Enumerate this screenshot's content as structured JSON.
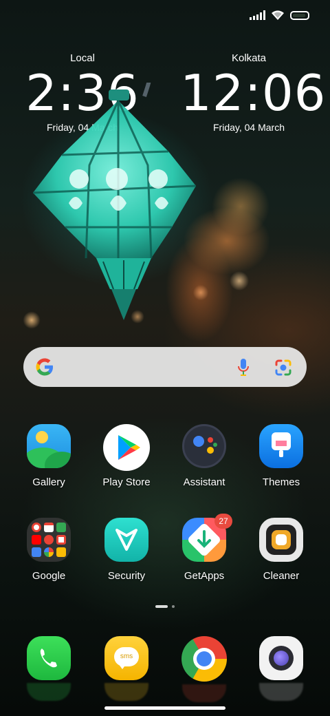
{
  "clocks": {
    "local": {
      "city": "Local",
      "time": "2:36",
      "date": "Friday, 04 March"
    },
    "remote": {
      "city": "Kolkata",
      "time": "12:06",
      "date": "Friday, 04 March"
    }
  },
  "status_bar": {
    "icons": [
      "signal-icon",
      "wifi-icon",
      "battery-icon"
    ]
  },
  "search": {
    "icons": [
      "google-logo-icon",
      "mic-icon",
      "google-lens-icon"
    ]
  },
  "apps": {
    "row1": [
      {
        "label": "Gallery",
        "icon": "gallery-icon"
      },
      {
        "label": "Play Store",
        "icon": "play-store-icon"
      },
      {
        "label": "Assistant",
        "icon": "assistant-icon"
      },
      {
        "label": "Themes",
        "icon": "themes-icon"
      }
    ],
    "row2": [
      {
        "label": "Google",
        "icon": "google-folder-icon"
      },
      {
        "label": "Security",
        "icon": "security-icon"
      },
      {
        "label": "GetApps",
        "icon": "getapps-icon",
        "badge": "27"
      },
      {
        "label": "Cleaner",
        "icon": "cleaner-icon"
      }
    ]
  },
  "dock": [
    {
      "icon": "phone-icon"
    },
    {
      "icon": "messages-icon",
      "text": "sms"
    },
    {
      "icon": "chrome-icon"
    },
    {
      "icon": "camera-icon"
    }
  ],
  "pager": {
    "pages": 2,
    "current": 1
  },
  "colors": {
    "badge": "#e84a3f",
    "search_bg": "#ebebeb",
    "lantern": "#3ee6c8"
  }
}
